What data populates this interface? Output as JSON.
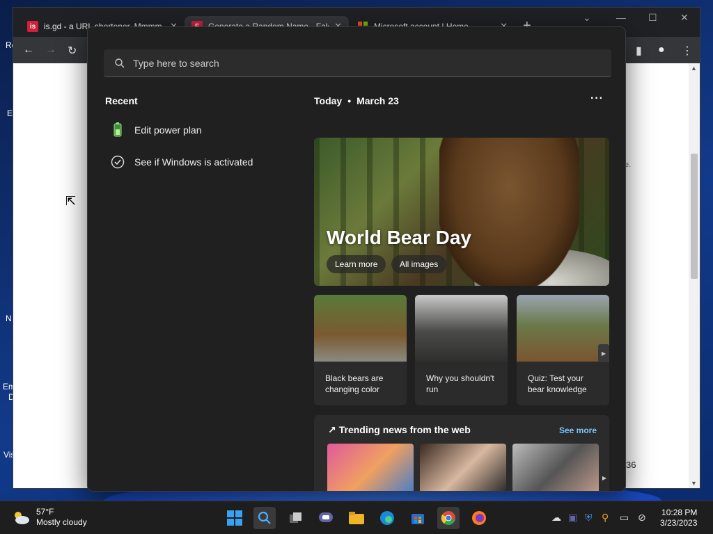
{
  "desktop": {
    "labels": [
      "Re",
      "E",
      "N",
      "Em",
      "D",
      "Vis"
    ]
  },
  "browser": {
    "tabs": [
      {
        "title": "is.gd - a URL shortener. Mmmm",
        "favicon": "is"
      },
      {
        "title": "Generate a Random Name - Fake",
        "favicon": "F"
      },
      {
        "title": "Microsoft account | Home",
        "favicon": "ms"
      }
    ],
    "page_fragments": {
      "right_text": "e.",
      "number": "36"
    }
  },
  "search": {
    "placeholder": "Type here to search",
    "recent_title": "Recent",
    "recent_items": [
      {
        "label": "Edit power plan",
        "icon": "battery-settings-icon"
      },
      {
        "label": "See if Windows is activated",
        "icon": "check-circle-icon"
      }
    ],
    "today_label": "Today",
    "date_label": "March 23",
    "hero": {
      "title": "World Bear Day",
      "learn_more": "Learn more",
      "all_images": "All images"
    },
    "cards": [
      {
        "caption": "Black bears are changing color"
      },
      {
        "caption": "Why you shouldn't run"
      },
      {
        "caption": "Quiz: Test your bear knowledge"
      }
    ],
    "trending": {
      "title": "Trending news from the web",
      "see_more": "See more"
    }
  },
  "taskbar": {
    "weather_temp": "57°F",
    "weather_desc": "Mostly cloudy",
    "time": "10:28 PM",
    "date": "3/23/2023"
  },
  "colors": {
    "flyout_bg": "#202020",
    "accent_link": "#7cc4ff",
    "taskbar_bg": "#1e1e1e"
  }
}
